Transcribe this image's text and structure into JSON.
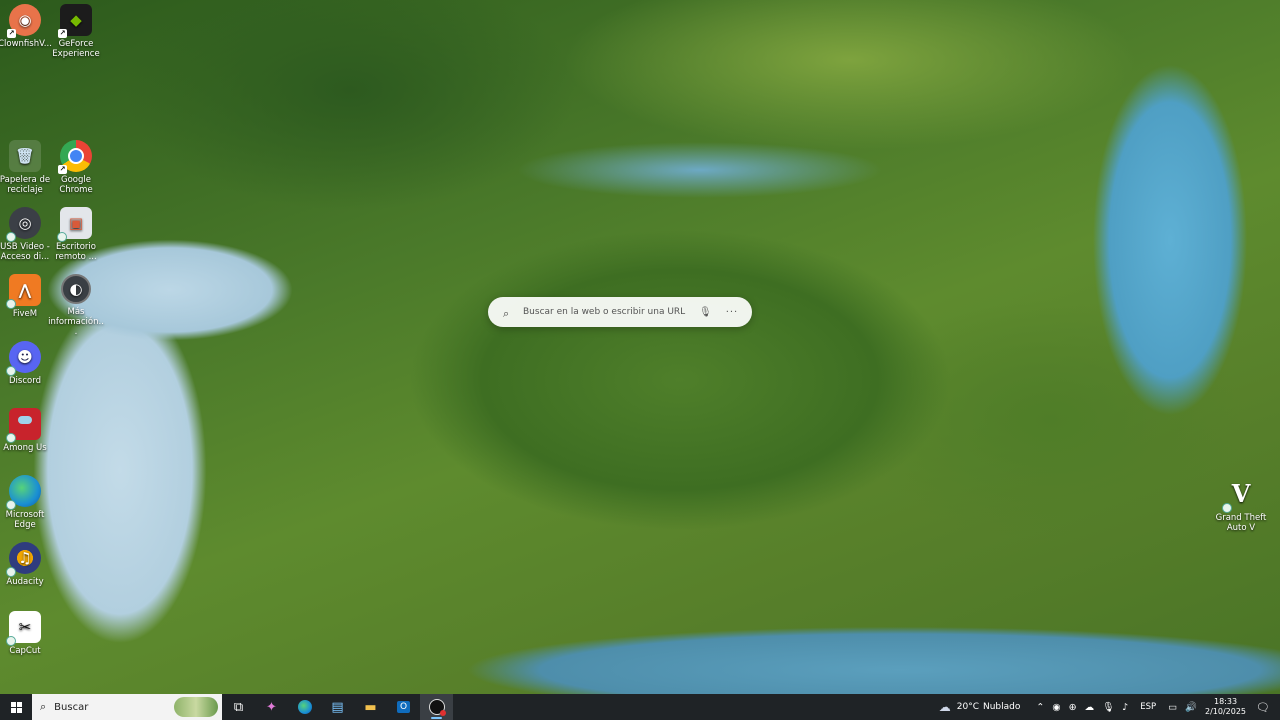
{
  "desktop": {
    "icons_left": [
      {
        "label": "ClownfishV...",
        "glyph": "◉",
        "color": "#e8734a"
      },
      {
        "label": "GeForce Experience",
        "glyph": "◆",
        "color": "#2b2b2b"
      },
      {
        "label": "Papelera de reciclaje",
        "glyph": "🗑",
        "color": "#6aa0c8"
      },
      {
        "label": "Google Chrome",
        "glyph": "●",
        "color": "#4285f4"
      },
      {
        "label": "USB Video - Acceso di...",
        "glyph": "◎",
        "color": "#556"
      },
      {
        "label": "Escritorio remoto ...",
        "glyph": "▣",
        "color": "#d85a3a"
      },
      {
        "label": "FiveM",
        "glyph": "⋀",
        "color": "#f07a22"
      },
      {
        "label": "Más información...",
        "glyph": "◐",
        "color": "#3a3f44"
      },
      {
        "label": "Discord",
        "glyph": "☻",
        "color": "#5865f2"
      },
      {
        "label": "Among Us",
        "glyph": "▲",
        "color": "#c8232c"
      },
      {
        "label": "Microsoft Edge",
        "glyph": "◒",
        "color": "#1a8fd4"
      },
      {
        "label": "Audacity",
        "glyph": "♫",
        "color": "#2f3c7e"
      },
      {
        "label": "CapCut",
        "glyph": "✂",
        "color": "#111"
      }
    ],
    "icon_right": {
      "label": "Grand Theft Auto V",
      "glyph": "V",
      "color": "#1b1b1b"
    }
  },
  "search": {
    "placeholder": "Buscar en la web o escribir una URL",
    "icon": "search-icon",
    "mic_icon": "mic-icon",
    "more_icon": "more-icon"
  },
  "taskbar": {
    "start_icon": "windows-icon",
    "search_label": "Buscar",
    "apps": [
      "task-view",
      "copilot",
      "edge",
      "store",
      "file-explorer",
      "outlook",
      "obs"
    ],
    "weather": {
      "temp": "20°C",
      "condition": "Nublado"
    },
    "language": "ESP",
    "time": "18:33",
    "date": "2/10/2025"
  }
}
